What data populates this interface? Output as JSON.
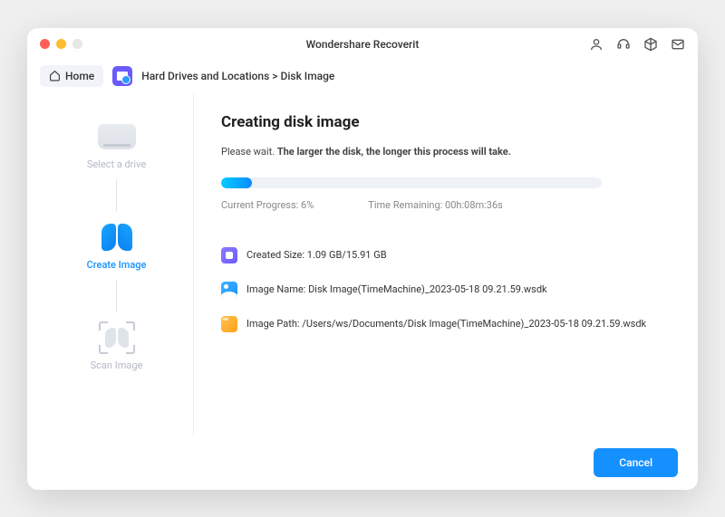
{
  "window": {
    "title": "Wondershare Recoverit"
  },
  "toolbar": {
    "home_label": "Home",
    "breadcrumb_root": "Hard Drives and Locations",
    "breadcrumb_sep": " > ",
    "breadcrumb_current": "Disk Image"
  },
  "sidebar": {
    "step1_label": "Select a drive",
    "step2_label": "Create Image",
    "step3_label": "Scan Image"
  },
  "main": {
    "heading": "Creating disk image",
    "wait_prefix": "Please wait. ",
    "wait_bold": "The larger the disk, the longer this process will take.",
    "progress_label": "Current Progress: ",
    "progress_value": "6%",
    "time_label": "Time Remaining: ",
    "time_value": "00h:08m:36s",
    "created_size_label": "Created Size: ",
    "created_size_value": "1.09 GB/15.91 GB",
    "image_name_label": "Image Name: ",
    "image_name_value": "Disk Image(TimeMachine)_2023-05-18 09.21.59.wsdk",
    "image_path_label": "Image Path: ",
    "image_path_value": "/Users/ws/Documents/Disk Image(TimeMachine)_2023-05-18 09.21.59.wsdk"
  },
  "footer": {
    "cancel_label": "Cancel"
  }
}
